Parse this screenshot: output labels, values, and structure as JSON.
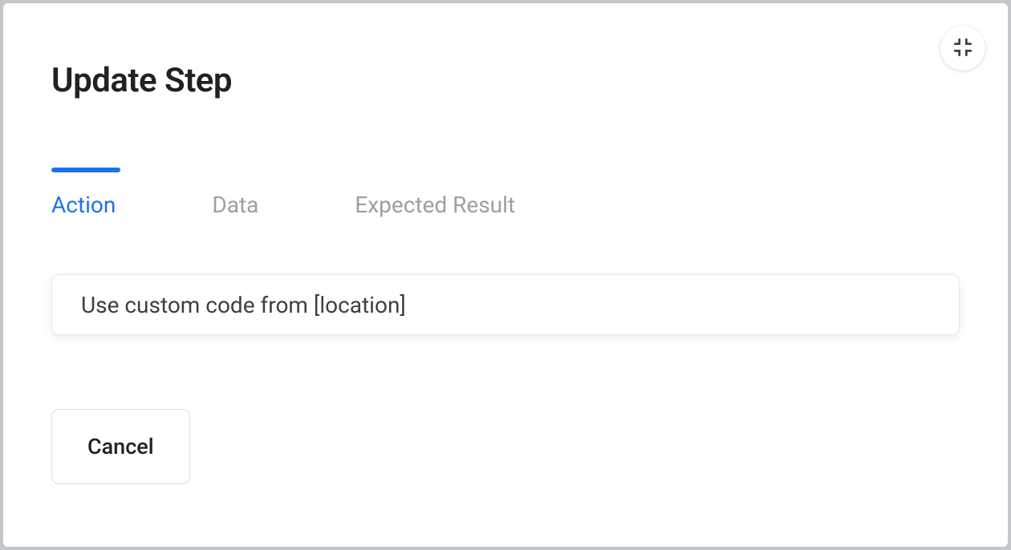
{
  "modal": {
    "title": "Update Step",
    "tabs": [
      {
        "label": "Action"
      },
      {
        "label": "Data"
      },
      {
        "label": "Expected Result"
      }
    ],
    "input": {
      "value": "Use custom code from [location]"
    },
    "cancel_label": "Cancel"
  }
}
